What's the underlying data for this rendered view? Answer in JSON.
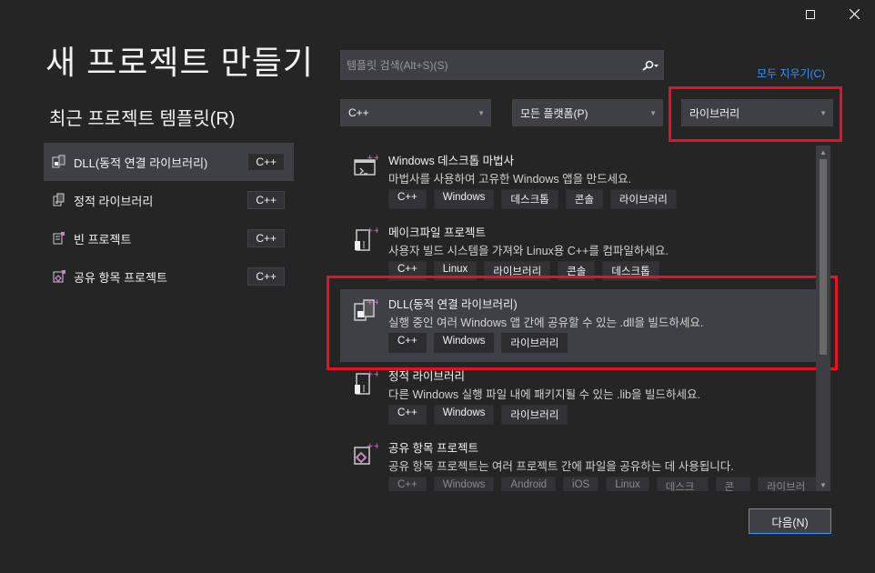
{
  "window": {
    "maximize_icon": "maximize-icon",
    "close_icon": "close-icon"
  },
  "page": {
    "title": "새 프로젝트 만들기",
    "recent_title": "최근 프로젝트 템플릿(R)"
  },
  "recent": [
    {
      "label": "DLL(동적 연결 라이브러리)",
      "tag": "C++",
      "icon": "dll-icon"
    },
    {
      "label": "정적 라이브러리",
      "tag": "C++",
      "icon": "static-lib-icon"
    },
    {
      "label": "빈 프로젝트",
      "tag": "C++",
      "icon": "empty-project-icon"
    },
    {
      "label": "공유 항목 프로젝트",
      "tag": "C++",
      "icon": "shared-items-icon"
    }
  ],
  "search": {
    "placeholder": "템플릿 검색(Alt+S)(S)",
    "icon": "search-icon"
  },
  "clear_all": "모두 지우기(C)",
  "filters": {
    "language": "C++",
    "platform": "모든 플랫폼(P)",
    "type": "라이브러리"
  },
  "templates": [
    {
      "name": "Windows 데스크톱 마법사",
      "desc": "마법사를 사용하여 고유한 Windows 앱을 만드세요.",
      "tags": [
        "C++",
        "Windows",
        "데스크톱",
        "콘솔",
        "라이브러리"
      ]
    },
    {
      "name": "메이크파일 프로젝트",
      "desc": "사용자 빌드 시스템을 가져와 Linux용 C++를 컴파일하세요.",
      "tags": [
        "C++",
        "Linux",
        "라이브러리",
        "콘솔",
        "데스크톱"
      ]
    },
    {
      "name": "DLL(동적 연결 라이브러리)",
      "desc": "실행 중인 여러 Windows 앱 간에 공유할 수 있는 .dll을 빌드하세요.",
      "tags": [
        "C++",
        "Windows",
        "라이브러리"
      ]
    },
    {
      "name": "정적 라이브러리",
      "desc": "다른 Windows 실행 파일 내에 패키지될 수 있는 .lib을 빌드하세요.",
      "tags": [
        "C++",
        "Windows",
        "라이브러리"
      ]
    },
    {
      "name": "공유 항목 프로젝트",
      "desc": "공유 항목 프로젝트는 여러 프로젝트 간에 파일을 공유하는 데 사용됩니다.",
      "tags": [
        "C++",
        "Windows",
        "Android",
        "iOS",
        "Linux",
        "데스크톱",
        "콘솔",
        "라이브러리"
      ]
    }
  ],
  "next_button": "다음(N)",
  "colors": {
    "background": "#252526",
    "accent": "#3794ff",
    "highlight": "#e81123",
    "selected": "#3f3f46"
  }
}
